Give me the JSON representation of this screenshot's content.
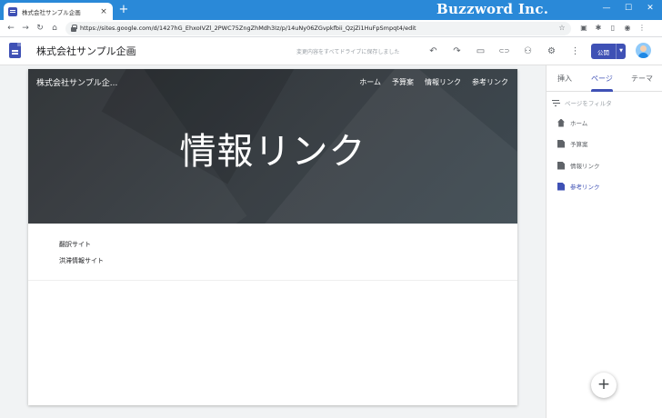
{
  "browser": {
    "tab_title": "株式会社サンプル企画",
    "tab_close": "×",
    "new_tab": "+",
    "url": "https://sites.google.com/d/1427hG_EhxoIVZl_2PWC75ZngZhMdh3Iz/p/14uNy06ZGvpkfbii_QzjZi1HuFpSmpqt4/edit",
    "brand": "Buzzword Inc.",
    "back": "←",
    "forward": "→",
    "reload": "↻",
    "home": "⌂",
    "window_min": "—",
    "window_max": "☐",
    "window_close": "✕"
  },
  "header": {
    "site_name": "株式会社サンプル企画",
    "save_status": "変更内容をすべてドライブに保存しました",
    "undo": "↶",
    "redo": "↷",
    "preview": "▭",
    "link": "⊂⊃",
    "share": "⚇",
    "settings": "⚙",
    "more": "⋮",
    "publish": "公開",
    "publish_caret": "▼"
  },
  "banner": {
    "site_title": "株式会社サンプル企...",
    "nav": [
      "ホーム",
      "予算案",
      "情報リンク",
      "参考リンク"
    ],
    "page_title": "情報リンク"
  },
  "content": {
    "links": [
      "翻訳サイト",
      "洪滞情報サイト"
    ]
  },
  "panel": {
    "tabs": [
      "挿入",
      "ページ",
      "テーマ"
    ],
    "filter_placeholder": "ページをフィルタ",
    "pages": [
      {
        "label": "ホーム",
        "icon": "home-icon"
      },
      {
        "label": "予算案",
        "icon": "page-icon"
      },
      {
        "label": "情報リンク",
        "icon": "page-icon"
      },
      {
        "label": "参考リンク",
        "icon": "page-icon",
        "active": true
      }
    ],
    "fab": "+"
  },
  "colors": {
    "accent": "#3f51b5",
    "browser_frame": "#2a89d8"
  }
}
